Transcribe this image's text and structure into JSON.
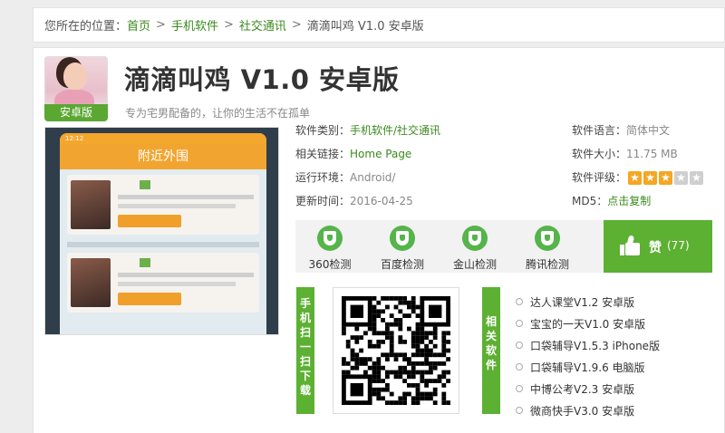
{
  "breadcrumb": {
    "prefix": "您所在的位置：",
    "items": [
      "首页",
      "手机软件",
      "社交通讯"
    ],
    "current": "滴滴叫鸡 V1.0 安卓版",
    "separator": ">"
  },
  "app": {
    "badge": "安卓版",
    "title": "滴滴叫鸡 V1.0 安卓版",
    "subtitle": "专为宅男配备的，让你的生活不在孤单"
  },
  "screenshot": {
    "header_text": "附近外围",
    "status_text": "12:12"
  },
  "info": {
    "category_label": "软件类别：",
    "category_value": "手机软件/社交通讯",
    "link_label": "相关链接：",
    "link_value": "Home Page",
    "env_label": "运行环境：",
    "env_value": "Android/",
    "update_label": "更新时间：",
    "update_value": "2016-04-25",
    "lang_label": "软件语言：",
    "lang_value": "简体中文",
    "size_label": "软件大小：",
    "size_value": "11.75 MB",
    "rating_label": "软件评级：",
    "rating": 3,
    "rating_max": 5,
    "md5_label": "MD5：",
    "md5_value": "点击复制"
  },
  "checks": [
    "360检测",
    "百度检测",
    "金山检测",
    "腾讯检测"
  ],
  "like": {
    "label": "赞",
    "count": "(77)"
  },
  "scan_tab": [
    "手",
    "机",
    "扫",
    "一",
    "扫",
    "下",
    "载"
  ],
  "related_tab": [
    "相",
    "关",
    "软",
    "件"
  ],
  "related": [
    "达人课堂V1.2 安卓版",
    "宝宝的一天V1.0 安卓版",
    "口袋辅导V1.5.3 iPhone版",
    "口袋辅导V1.9.6 电脑版",
    "中博公考V2.3 安卓版",
    "微商快手V3.0 安卓版"
  ],
  "colors": {
    "accent_green": "#5cb032",
    "link_green": "#3b8a1e",
    "star_on": "#f5a623",
    "star_off": "#cfcfcf"
  }
}
